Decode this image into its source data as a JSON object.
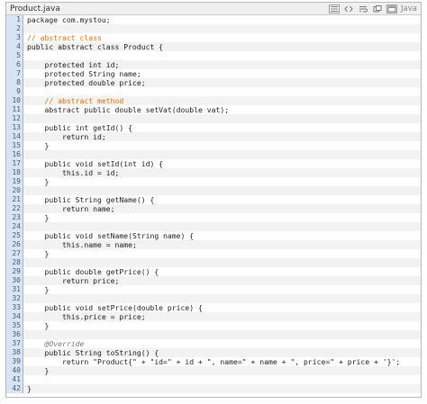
{
  "editor": {
    "filename": "Product.java",
    "language": "Java",
    "toolbar": {
      "icons": [
        "view-source-icon",
        "code-icon",
        "wrap-lines-icon",
        "copy-icon",
        "popup-icon"
      ]
    }
  },
  "code": {
    "lines": [
      {
        "n": "1",
        "text": "package com.mystou;",
        "kind": "code"
      },
      {
        "n": "2",
        "text": "",
        "kind": "code"
      },
      {
        "n": "3",
        "text": "// abstract class",
        "kind": "comment"
      },
      {
        "n": "4",
        "text": "public abstract class Product {",
        "kind": "code"
      },
      {
        "n": "5",
        "text": "",
        "kind": "code"
      },
      {
        "n": "6",
        "text": "    protected int id;",
        "kind": "code"
      },
      {
        "n": "7",
        "text": "    protected String name;",
        "kind": "code"
      },
      {
        "n": "8",
        "text": "    protected double price;",
        "kind": "code"
      },
      {
        "n": "9",
        "text": "",
        "kind": "code"
      },
      {
        "n": "10",
        "text": "    // abstract method",
        "kind": "comment"
      },
      {
        "n": "11",
        "text": "    abstract public double setVat(double vat);",
        "kind": "code"
      },
      {
        "n": "12",
        "text": "",
        "kind": "code"
      },
      {
        "n": "13",
        "text": "    public int getId() {",
        "kind": "code"
      },
      {
        "n": "14",
        "text": "        return id;",
        "kind": "code"
      },
      {
        "n": "15",
        "text": "    }",
        "kind": "code"
      },
      {
        "n": "16",
        "text": "",
        "kind": "code"
      },
      {
        "n": "17",
        "text": "    public void setId(int id) {",
        "kind": "code"
      },
      {
        "n": "18",
        "text": "        this.id = id;",
        "kind": "code"
      },
      {
        "n": "19",
        "text": "    }",
        "kind": "code"
      },
      {
        "n": "20",
        "text": "",
        "kind": "code"
      },
      {
        "n": "21",
        "text": "    public String getName() {",
        "kind": "code"
      },
      {
        "n": "22",
        "text": "        return name;",
        "kind": "code"
      },
      {
        "n": "23",
        "text": "    }",
        "kind": "code"
      },
      {
        "n": "24",
        "text": "",
        "kind": "code"
      },
      {
        "n": "25",
        "text": "    public void setName(String name) {",
        "kind": "code"
      },
      {
        "n": "26",
        "text": "        this.name = name;",
        "kind": "code"
      },
      {
        "n": "27",
        "text": "    }",
        "kind": "code"
      },
      {
        "n": "28",
        "text": "",
        "kind": "code"
      },
      {
        "n": "29",
        "text": "    public double getPrice() {",
        "kind": "code"
      },
      {
        "n": "30",
        "text": "        return price;",
        "kind": "code"
      },
      {
        "n": "31",
        "text": "    }",
        "kind": "code"
      },
      {
        "n": "32",
        "text": "",
        "kind": "code"
      },
      {
        "n": "33",
        "text": "    public void setPrice(double price) {",
        "kind": "code"
      },
      {
        "n": "34",
        "text": "        this.price = price;",
        "kind": "code"
      },
      {
        "n": "35",
        "text": "    }",
        "kind": "code"
      },
      {
        "n": "36",
        "text": "",
        "kind": "code"
      },
      {
        "n": "37",
        "text": "    @Override",
        "kind": "annotation"
      },
      {
        "n": "38",
        "text": "    public String toString() {",
        "kind": "code"
      },
      {
        "n": "39",
        "text": "        return \"Product{\" + \"id=\" + id + \", name=\" + name + \", price=\" + price + '}';",
        "kind": "code"
      },
      {
        "n": "40",
        "text": "    }",
        "kind": "code"
      },
      {
        "n": "41",
        "text": "",
        "kind": "code"
      },
      {
        "n": "42",
        "text": "}",
        "kind": "code"
      }
    ]
  },
  "colors": {
    "comment": "#d9730d",
    "gutter_bg": "#d8e4f3",
    "stripe": "#f2f2f2"
  }
}
